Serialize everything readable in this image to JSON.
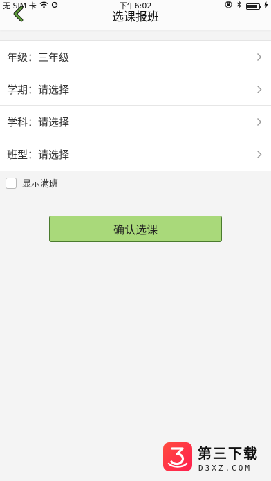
{
  "status_bar": {
    "carrier": "无 SIM 卡",
    "time": "下午6:02",
    "wifi_icon": "wifi-icon",
    "sync_icon": "sync-icon",
    "lock_icon": "rotation-lock-icon",
    "bluetooth_icon": "bluetooth-icon",
    "charging_icon": "charging-icon"
  },
  "header": {
    "title": "选课报班",
    "back_icon": "back-chevron-icon",
    "accent_color": "#4f8f2f"
  },
  "form": {
    "rows": [
      {
        "label": "年级：",
        "value": "三年级"
      },
      {
        "label": "学期：",
        "value": "请选择"
      },
      {
        "label": "学科：",
        "value": "请选择"
      },
      {
        "label": "班型：",
        "value": "请选择"
      }
    ],
    "chevron_icon": "chevron-right-icon"
  },
  "options": {
    "show_full_label": "显示满班"
  },
  "actions": {
    "confirm_label": "确认选课",
    "button_color": "#a9d97a"
  },
  "watermark": {
    "title": "第三下载",
    "subtitle": "D3XZ.COM",
    "logo_color": "#ff3b4a"
  }
}
